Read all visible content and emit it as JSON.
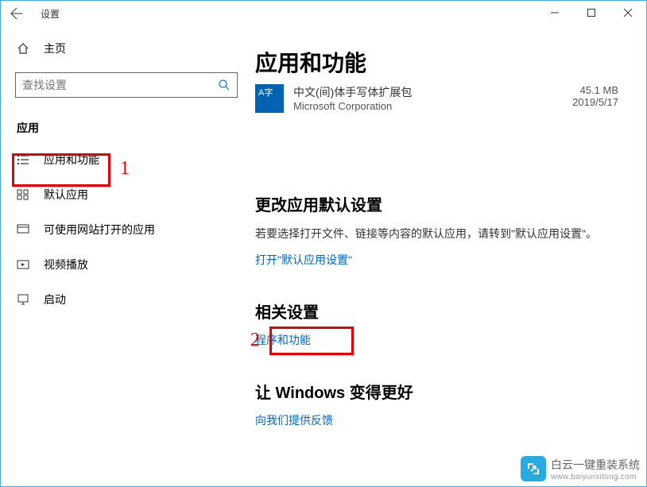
{
  "titlebar": {
    "title": "设置"
  },
  "sidebar": {
    "home_label": "主页",
    "search": {
      "placeholder": "查找设置"
    },
    "section_label": "应用",
    "items": [
      {
        "label": "应用和功能",
        "icon": "apps-features-icon"
      },
      {
        "label": "默认应用",
        "icon": "default-apps-icon"
      },
      {
        "label": "可使用网站打开的应用",
        "icon": "web-apps-icon"
      },
      {
        "label": "视频播放",
        "icon": "video-icon"
      },
      {
        "label": "启动",
        "icon": "startup-icon"
      }
    ]
  },
  "main": {
    "page_title": "应用和功能",
    "app": {
      "icon_text": "A字",
      "name_cut": "中文(间)体手写体扩展包",
      "publisher": "Microsoft Corporation",
      "size": "45.1 MB",
      "date": "2019/5/17"
    },
    "section1": {
      "title": "更改应用默认设置",
      "desc": "若要选择打开文件、链接等内容的默认应用，请转到\"默认应用设置\"。",
      "link": "打开\"默认应用设置\""
    },
    "section2": {
      "title": "相关设置",
      "link": "程序和功能"
    },
    "section3": {
      "title": "让 Windows 变得更好",
      "link": "向我们提供反馈"
    }
  },
  "annotations": {
    "num1": "1",
    "num2": "2"
  },
  "watermark": {
    "main": "白云一键重装系统",
    "sub": "www.baiyunxitong.com"
  }
}
